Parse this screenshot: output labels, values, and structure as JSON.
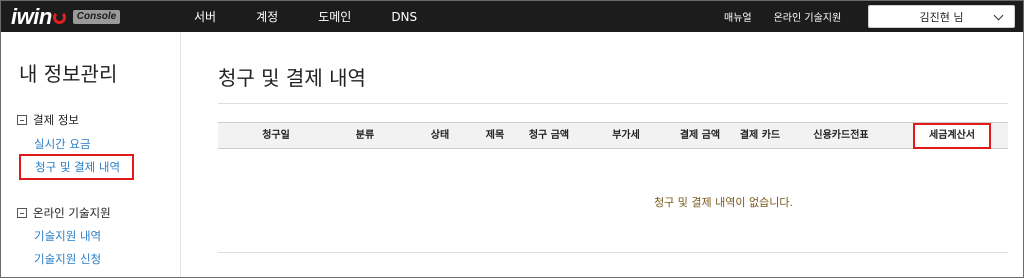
{
  "brand": {
    "logo_text": "iwin",
    "badge": "Console"
  },
  "top_nav": [
    "서버",
    "계정",
    "도메인",
    "DNS"
  ],
  "top_links": [
    "매뉴얼",
    "온라인 기술지원"
  ],
  "user_menu": {
    "label": "김진현 님"
  },
  "sidebar": {
    "title": "내 정보관리",
    "groups": [
      {
        "label": "결제 정보",
        "items": [
          "실시간 요금",
          "청구 및 결제 내역"
        ]
      },
      {
        "label": "온라인 기술지원",
        "items": [
          "기술지원 내역",
          "기술지원 신청"
        ]
      }
    ],
    "active_item": "청구 및 결제 내역"
  },
  "main": {
    "title": "청구 및 결제 내역",
    "columns": [
      "청구일",
      "분류",
      "상태",
      "제목",
      "청구 금액",
      "부가세",
      "결제 금액",
      "결제 카드",
      "신용카드전표",
      "세금계산서"
    ],
    "empty_message": "청구 및 결제 내역이 없습니다."
  },
  "colors": {
    "topbar": "#1c1c1c",
    "link": "#2a7fc7",
    "highlight": "#e21a1a",
    "empty_text": "#7a5a1e"
  }
}
